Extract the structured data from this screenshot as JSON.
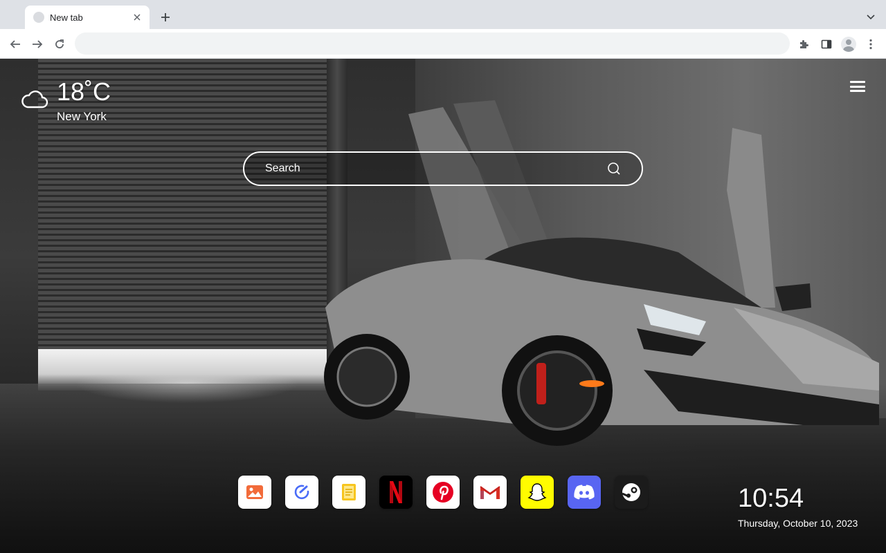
{
  "browser": {
    "tab_title": "New tab",
    "omnibox_value": "",
    "icons": [
      "close-icon",
      "plus-icon",
      "chevron-down-icon",
      "back-arrow-icon",
      "forward-arrow-icon",
      "reload-icon",
      "puzzle-icon",
      "side-panel-icon",
      "profile-icon",
      "kebab-menu-icon"
    ]
  },
  "weather": {
    "temperature": "18˚C",
    "city": "New York",
    "icon": "cloud-icon"
  },
  "search": {
    "placeholder": "Search",
    "icon": "search-icon"
  },
  "menu": {
    "icon": "hamburger-menu-icon"
  },
  "dock": {
    "items": [
      {
        "name": "photos",
        "icon": "image-icon",
        "bg": "#ffffff",
        "color": "#f26b3a"
      },
      {
        "name": "tasks",
        "icon": "check-circle-icon",
        "bg": "#ffffff",
        "color": "#4a6cf7"
      },
      {
        "name": "notes",
        "icon": "note-icon",
        "bg": "#ffffff",
        "color": "#f2b90c"
      },
      {
        "name": "netflix",
        "icon": "netflix-icon",
        "bg": "#000000",
        "color": "#e50914"
      },
      {
        "name": "pinterest",
        "icon": "pinterest-icon",
        "bg": "#ffffff",
        "color": "#e60023"
      },
      {
        "name": "gmail",
        "icon": "gmail-icon",
        "bg": "#ffffff",
        "color": "#d93025"
      },
      {
        "name": "snapchat",
        "icon": "snapchat-icon",
        "bg": "#fffc00",
        "color": "#ffffff"
      },
      {
        "name": "discord",
        "icon": "discord-icon",
        "bg": "#5865f2",
        "color": "#ffffff"
      },
      {
        "name": "steam",
        "icon": "steam-icon",
        "bg": "#1b1b1b",
        "color": "#ffffff"
      }
    ]
  },
  "clock": {
    "time": "10:54",
    "date": "Thursday, October 10, 2023"
  }
}
